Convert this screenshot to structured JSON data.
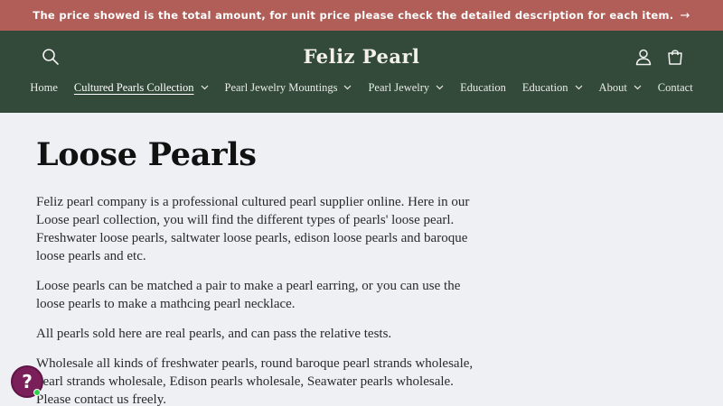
{
  "announcement": {
    "text": "The price showed is the total amount, for unit price please check the detailed description for each item.",
    "arrow": "→"
  },
  "header": {
    "logo": "Feliz Pearl",
    "icons": {
      "search": "search-icon",
      "account": "account-icon",
      "cart": "cart-icon"
    }
  },
  "nav": {
    "items": [
      {
        "label": "Home",
        "dropdown": false,
        "active": false
      },
      {
        "label": "Cultured Pearls Collection",
        "dropdown": true,
        "active": true
      },
      {
        "label": "Pearl Jewelry Mountings",
        "dropdown": true,
        "active": false
      },
      {
        "label": "Pearl Jewelry",
        "dropdown": true,
        "active": false
      },
      {
        "label": "Education",
        "dropdown": false,
        "active": false
      },
      {
        "label": "Education",
        "dropdown": true,
        "active": false
      },
      {
        "label": "About",
        "dropdown": true,
        "active": false
      },
      {
        "label": "Contact",
        "dropdown": false,
        "active": false
      }
    ]
  },
  "main": {
    "title": "Loose Pearls",
    "paragraphs": [
      "Feliz pearl company is a professional cultured pearl supplier online.  Here in our Loose pearl collection, you will find the different types of pearls' loose pearl. Freshwater loose pearls, saltwater loose pearls, edison loose pearls and baroque loose pearls and etc.",
      "Loose pearls can be matched a pair to make a pearl earring, or you can use the loose pearls to make a mathcing pearl necklace.",
      "All pearls sold here are real pearls, and can pass the relative tests.",
      "Wholesale all kinds of freshwater pearls, round baroque pearl strands wholesale, pearl strands wholesale, Edison pearls wholesale, Seawater pearls wholesale. Please contact us freely."
    ]
  },
  "help_widget": {
    "symbol": "?",
    "icon": "help-question-icon"
  },
  "colors": {
    "announcement_bg": "#b05e57",
    "header_bg": "#334a3b",
    "page_bg": "#eef0f4",
    "help_bg": "#7b1f5a",
    "online_dot": "#2fd04d"
  }
}
